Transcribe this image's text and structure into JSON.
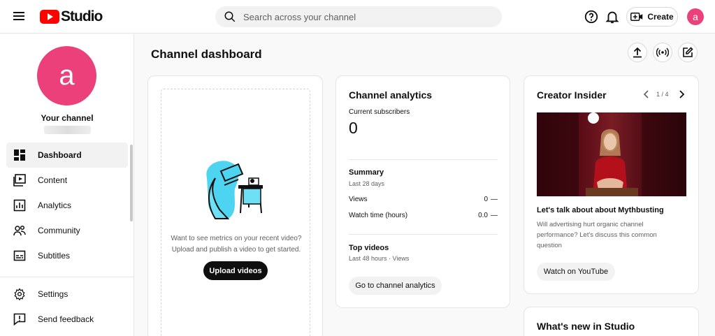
{
  "header": {
    "logo_text": "Studio",
    "search_placeholder": "Search across your channel",
    "create_label": "Create",
    "avatar_letter": "a"
  },
  "sidebar": {
    "avatar_letter": "a",
    "your_channel": "Your channel",
    "items": [
      {
        "label": "Dashboard",
        "icon": "dashboard-icon",
        "active": true
      },
      {
        "label": "Content",
        "icon": "content-icon"
      },
      {
        "label": "Analytics",
        "icon": "analytics-icon"
      },
      {
        "label": "Community",
        "icon": "community-icon"
      },
      {
        "label": "Subtitles",
        "icon": "subtitles-icon"
      }
    ],
    "bottom_items": [
      {
        "label": "Settings",
        "icon": "gear-icon"
      },
      {
        "label": "Send feedback",
        "icon": "feedback-icon"
      }
    ]
  },
  "main": {
    "title": "Channel dashboard",
    "upload_card": {
      "text_line1": "Want to see metrics on your recent video?",
      "text_line2": "Upload and publish a video to get started.",
      "button": "Upload videos"
    },
    "analytics_card": {
      "title": "Channel analytics",
      "subscribers_label": "Current subscribers",
      "subscribers_value": "0",
      "summary_title": "Summary",
      "summary_period": "Last 28 days",
      "rows": [
        {
          "label": "Views",
          "value": "0",
          "delta": "—"
        },
        {
          "label": "Watch time (hours)",
          "value": "0.0",
          "delta": "—"
        }
      ],
      "top_videos_title": "Top videos",
      "top_videos_period": "Last 48 hours · Views",
      "button": "Go to channel analytics"
    },
    "insider_card": {
      "title": "Creator Insider",
      "pager": "1 / 4",
      "video_title": "Let's talk about about Mythbusting",
      "description_line1": "Will advertising hurt organic channel",
      "description_line2": "performance? Let's discuss this common",
      "description_line3": "question",
      "button": "Watch on YouTube"
    },
    "whats_new_card": {
      "title": "What's new in Studio"
    }
  },
  "colors": {
    "brand_red": "#ff0000",
    "avatar_pink": "#ec407a"
  }
}
